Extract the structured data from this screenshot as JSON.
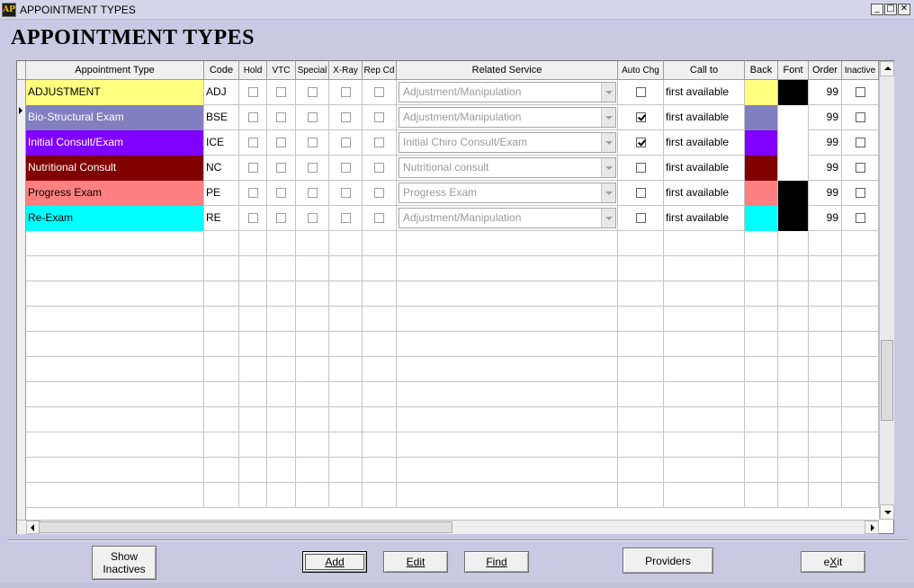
{
  "window": {
    "title": "APPOINTMENT TYPES",
    "icon_glyph": "AP",
    "controls": {
      "minimize": "_",
      "maximize": "□",
      "close": "✕"
    }
  },
  "page_title": "APPOINTMENT TYPES",
  "columns": {
    "appointment_type": "Appointment Type",
    "code": "Code",
    "hold": "Hold",
    "vtc": "VTC",
    "special": "Special",
    "xray": "X-Ray",
    "rep_cd": "Rep Cd",
    "related_service": "Related Service",
    "auto_chg": "Auto Chg",
    "call_to": "Call to",
    "back": "Back",
    "font": "Font",
    "order": "Order",
    "inactive": "Inactive"
  },
  "rows": [
    {
      "type": "ADJUSTMENT",
      "code": "ADJ",
      "hold": false,
      "vtc": false,
      "special": false,
      "xray": false,
      "rep_cd": false,
      "related_service": "Adjustment/Manipulation",
      "auto_chg": false,
      "call_to": "first available",
      "back_color": "#ffff80",
      "font_color": "#000000",
      "order": "99",
      "inactive": false,
      "selected": true
    },
    {
      "type": "Bio-Structural Exam",
      "code": "BSE",
      "hold": false,
      "vtc": false,
      "special": false,
      "xray": false,
      "rep_cd": false,
      "related_service": "Adjustment/Manipulation",
      "auto_chg": true,
      "call_to": "first available",
      "back_color": "#8080c0",
      "font_color": "#ffffff",
      "order": "99",
      "inactive": false,
      "selected": false
    },
    {
      "type": "Initial Consult/Exam",
      "code": "ICE",
      "hold": false,
      "vtc": false,
      "special": false,
      "xray": false,
      "rep_cd": false,
      "related_service": "Initial Chiro Consult/Exam",
      "auto_chg": true,
      "call_to": "first available",
      "back_color": "#8000ff",
      "font_color": "#ffffff",
      "order": "99",
      "inactive": false,
      "selected": false
    },
    {
      "type": "Nutritional Consult",
      "code": "NC",
      "hold": false,
      "vtc": false,
      "special": false,
      "xray": false,
      "rep_cd": false,
      "related_service": "Nutritional consult",
      "auto_chg": false,
      "call_to": "first available",
      "back_color": "#800000",
      "font_color": "#ffffff",
      "order": "99",
      "inactive": false,
      "selected": false
    },
    {
      "type": "Progress Exam",
      "code": "PE",
      "hold": false,
      "vtc": false,
      "special": false,
      "xray": false,
      "rep_cd": false,
      "related_service": "Progress Exam",
      "auto_chg": false,
      "call_to": "first available",
      "back_color": "#ff8080",
      "font_color": "#000000",
      "order": "99",
      "inactive": false,
      "selected": false
    },
    {
      "type": "Re-Exam",
      "code": "RE",
      "hold": false,
      "vtc": false,
      "special": false,
      "xray": false,
      "rep_cd": false,
      "related_service": "Adjustment/Manipulation",
      "auto_chg": false,
      "call_to": "first available",
      "back_color": "#00ffff",
      "font_color": "#000000",
      "order": "99",
      "inactive": false,
      "selected": false
    }
  ],
  "empty_row_count": 11,
  "buttons": {
    "show_inactives_line1": "Show",
    "show_inactives_line2": "Inactives",
    "add": "Add",
    "edit": "Edit",
    "find": "Find",
    "providers": "Providers",
    "exit_prefix": "e",
    "exit_mnemonic": "X",
    "exit_suffix": "it"
  }
}
